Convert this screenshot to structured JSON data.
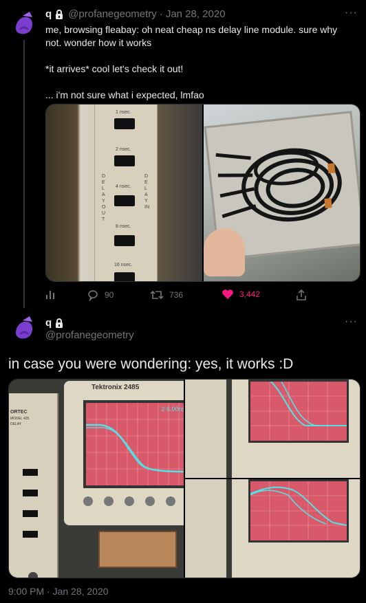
{
  "tweet1": {
    "display_name": "q",
    "handle": "@profanegeometry",
    "separator": "·",
    "date": "Jan 28, 2020",
    "text": "me, browsing fleabay: oh neat cheap ns delay line module. sure why not. wonder how it works\n\n*it arrives* cool let's check it out!\n\n... i'm not sure what i expected, lmfao",
    "panel_labels": [
      "1 nsec.",
      "2 nsec.",
      "4 nsec.",
      "8 nsec.",
      "16 nsec."
    ],
    "panel_side_left": "DELAY OUT",
    "panel_side_right": "DELAY IN",
    "actions": {
      "analytics": "",
      "replies": "90",
      "retweets": "736",
      "likes": "3,442"
    }
  },
  "tweet2": {
    "display_name": "q",
    "handle": "@profanegeometry",
    "text": "in case you were wondering: yes, it works :D",
    "scope_brand": "Tektronix 2485",
    "scope_readout": "2  6.00ns",
    "module_brand": "ORTEC",
    "module_model": "MODEL 425",
    "module_label": "DELAY",
    "timestamp": "9:00 PM · Jan 28, 2020"
  },
  "colors": {
    "background": "#000000",
    "text": "#e7e9ea",
    "muted": "#71767b",
    "like": "#f91880",
    "avatar": "#7b3fd0",
    "scope_screen": "#d85a6a",
    "scope_trace": "#52e3e8"
  }
}
